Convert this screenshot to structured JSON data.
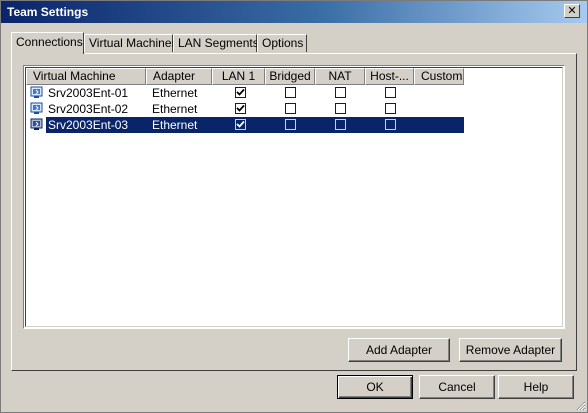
{
  "window": {
    "title": "Team Settings",
    "close_glyph": "✕"
  },
  "tabs": [
    {
      "label": "Connections",
      "selected": true
    },
    {
      "label": "Virtual Machines",
      "selected": false
    },
    {
      "label": "LAN Segments",
      "selected": false
    },
    {
      "label": "Options",
      "selected": false
    }
  ],
  "table": {
    "columns": [
      "Virtual Machine",
      "Adapter",
      "LAN 1",
      "Bridged",
      "NAT",
      "Host-...",
      "Custom"
    ],
    "rows": [
      {
        "vm": "Srv2003Ent-01",
        "adapter": "Ethernet",
        "lan1": true,
        "bridged": false,
        "nat": false,
        "host": false,
        "selected": false
      },
      {
        "vm": "Srv2003Ent-02",
        "adapter": "Ethernet",
        "lan1": true,
        "bridged": false,
        "nat": false,
        "host": false,
        "selected": false
      },
      {
        "vm": "Srv2003Ent-03",
        "adapter": "Ethernet",
        "lan1": true,
        "bridged": false,
        "nat": false,
        "host": false,
        "selected": true
      }
    ]
  },
  "buttons": {
    "add_adapter": "Add Adapter",
    "remove_adapter": "Remove Adapter",
    "ok": "OK",
    "cancel": "Cancel",
    "help": "Help"
  },
  "colors": {
    "selection": "#0a246a",
    "face": "#d4d0c8",
    "title_start": "#0a246a",
    "title_end": "#a6caf0"
  }
}
